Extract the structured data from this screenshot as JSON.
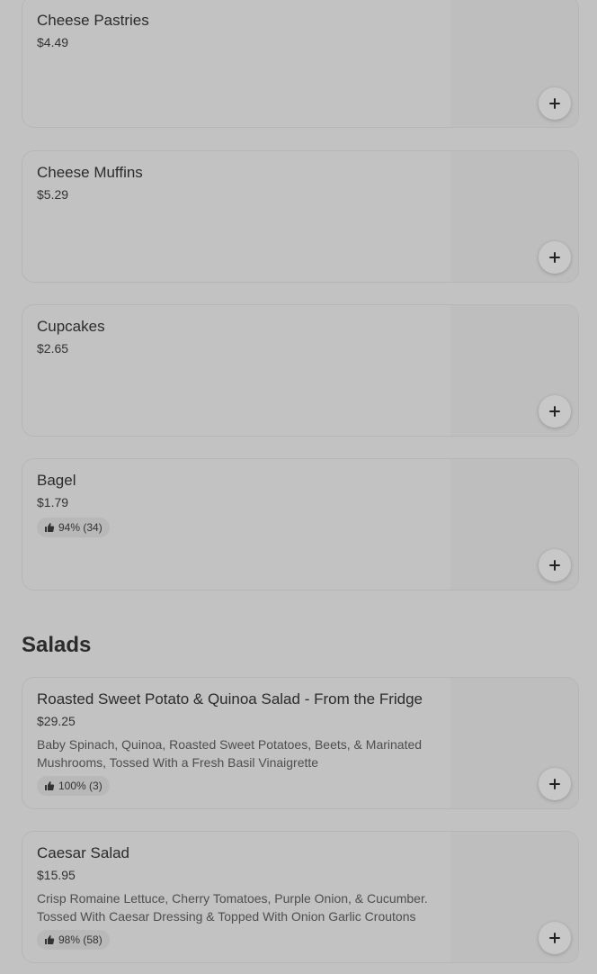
{
  "colors": {
    "background": "#c2c2c2",
    "card_border": "#b6b6b6",
    "text_primary": "#2b2b2b",
    "rating_badge": "#b8b8b8"
  },
  "icons": {
    "add": "plus-icon",
    "rating": "thumbs-up-icon"
  },
  "items_top": [
    {
      "name": "Cheese Pastries",
      "price": "$4.49"
    },
    {
      "name": "Cheese Muffins",
      "price": "$5.29"
    },
    {
      "name": "Cupcakes",
      "price": "$2.65"
    },
    {
      "name": "Bagel",
      "price": "$1.79",
      "rating": "94% (34)"
    }
  ],
  "salads": {
    "title": "Salads",
    "items": [
      {
        "name": "Roasted Sweet Potato & Quinoa Salad - From the Fridge",
        "price": "$29.25",
        "description": "Baby Spinach, Quinoa, Roasted Sweet Potatoes, Beets, & Marinated Mushrooms, Tossed With a Fresh Basil Vinaigrette",
        "rating": "100% (3)"
      },
      {
        "name": "Caesar Salad",
        "price": "$15.95",
        "description": "Crisp Romaine Lettuce, Cherry Tomatoes, Purple Onion, & Cucumber. Tossed With Caesar Dressing & Topped With Onion Garlic Croutons",
        "rating": "98% (58)"
      }
    ]
  }
}
